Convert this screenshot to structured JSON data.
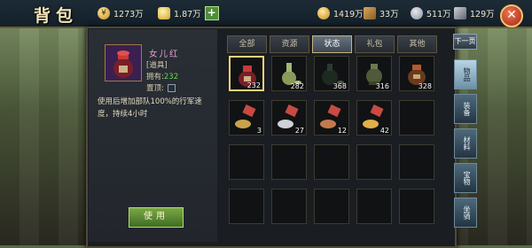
{
  "window": {
    "title": "背包"
  },
  "resources": [
    {
      "icon": "coin-icon",
      "value": "1273万"
    },
    {
      "icon": "gold-ingot-icon",
      "value": "1.87万"
    },
    {
      "icon": "grain-icon",
      "value": "1419万"
    },
    {
      "icon": "wood-icon",
      "value": "33万"
    },
    {
      "icon": "stone-icon",
      "value": "511万"
    },
    {
      "icon": "iron-icon",
      "value": "129万"
    }
  ],
  "detail": {
    "name": "女儿红",
    "type": "[道具]",
    "own_label": "拥有:",
    "own_count": "232",
    "pin_label": "置顶:",
    "description": "使用后增加部队100%的行军速度，持续4小时",
    "use_button": "使用"
  },
  "tabs": [
    "全部",
    "资源",
    "状态",
    "礼包",
    "其他"
  ],
  "active_tab": "状态",
  "items": [
    {
      "name": "wine-jar",
      "qty": "232",
      "selected": true
    },
    {
      "name": "wine-bottle",
      "qty": "282"
    },
    {
      "name": "black-wine-jar",
      "qty": "368"
    },
    {
      "name": "bronze-vessel",
      "qty": "316"
    },
    {
      "name": "clay-wine-jar",
      "qty": "328"
    },
    {
      "name": "horse-token",
      "qty": "3"
    },
    {
      "name": "horse-token-silver",
      "qty": "27"
    },
    {
      "name": "horse-token-copper",
      "qty": "12"
    },
    {
      "name": "horse-token-gold",
      "qty": "42"
    }
  ],
  "side_nav": {
    "next_label": "下一页",
    "tabs": [
      "物品",
      "装备",
      "材料",
      "宝物",
      "坐骑"
    ],
    "active": "物品"
  }
}
